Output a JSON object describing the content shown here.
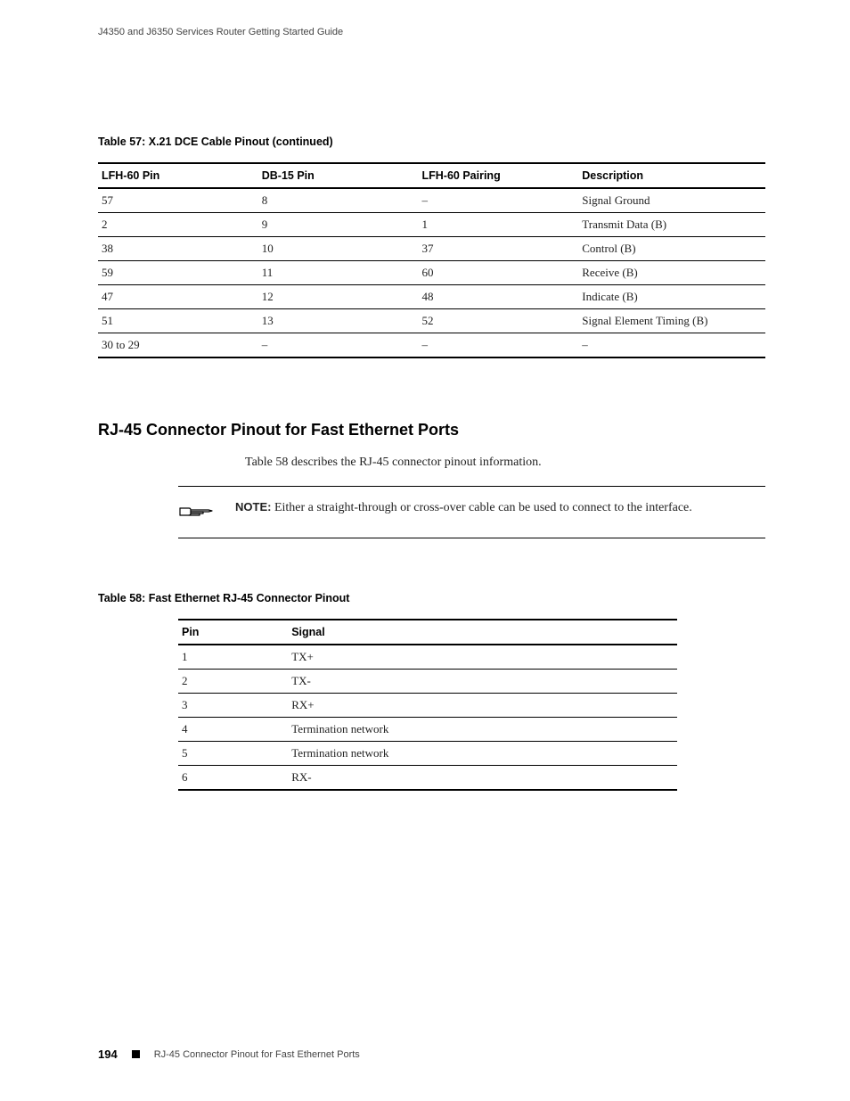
{
  "running_head": "J4350 and J6350 Services Router Getting Started Guide",
  "table57": {
    "caption": "Table 57:  X.21 DCE Cable Pinout (continued)",
    "headers": [
      "LFH-60 Pin",
      "DB-15 Pin",
      "LFH-60 Pairing",
      "Description"
    ],
    "rows": [
      [
        "57",
        "8",
        "–",
        "Signal Ground"
      ],
      [
        "2",
        "9",
        "1",
        "Transmit Data (B)"
      ],
      [
        "38",
        "10",
        "37",
        "Control (B)"
      ],
      [
        "59",
        "11",
        "60",
        "Receive (B)"
      ],
      [
        "47",
        "12",
        "48",
        "Indicate (B)"
      ],
      [
        "51",
        "13",
        "52",
        "Signal Element Timing (B)"
      ],
      [
        "30 to 29",
        "–",
        "–",
        "–"
      ]
    ]
  },
  "section_heading": "RJ-45 Connector Pinout for Fast Ethernet Ports",
  "body_text": "Table 58 describes the RJ-45 connector pinout information.",
  "note": {
    "label": "NOTE:",
    "text": "Either a straight-through or cross-over cable can be used to connect to the interface."
  },
  "table58": {
    "caption": "Table 58:  Fast Ethernet RJ-45 Connector Pinout",
    "headers": [
      "Pin",
      "Signal"
    ],
    "rows": [
      [
        "1",
        "TX+"
      ],
      [
        "2",
        "TX-"
      ],
      [
        "3",
        "RX+"
      ],
      [
        "4",
        "Termination network"
      ],
      [
        "5",
        "Termination network"
      ],
      [
        "6",
        "RX-"
      ]
    ]
  },
  "footer": {
    "page_number": "194",
    "text": "RJ-45 Connector Pinout for Fast Ethernet Ports"
  }
}
